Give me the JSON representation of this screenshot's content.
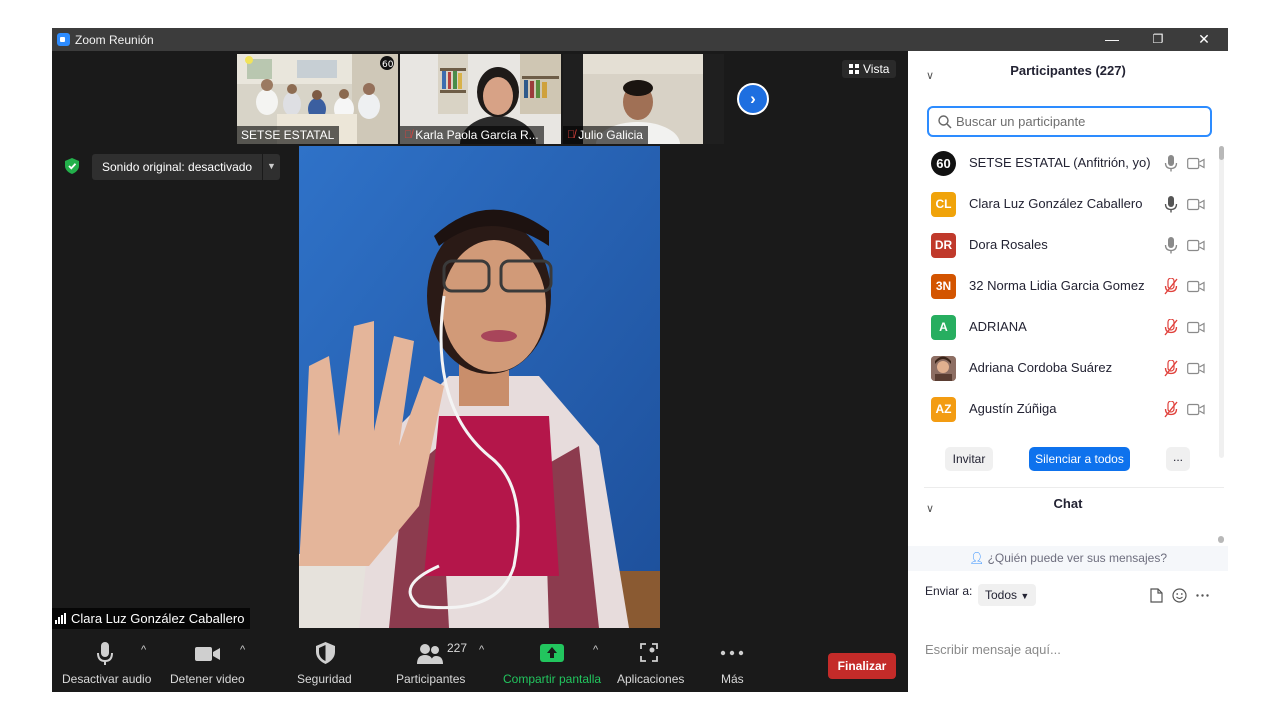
{
  "window": {
    "title": "Zoom Reunión",
    "minimize": "—",
    "restore": "❐",
    "close": "✕"
  },
  "thumbnails": [
    {
      "name": "SETSE ESTATAL",
      "muted": false
    },
    {
      "name": "Karla Paola García R...",
      "muted": true
    },
    {
      "name": "Julio Galicia",
      "muted": true
    }
  ],
  "view_button": "Vista",
  "sound_bar": {
    "label": "Sonido original: desactivado"
  },
  "active_speaker": "Clara Luz González Caballero",
  "toolbar": {
    "audio_label": "Desactivar audio",
    "video_label": "Detener video",
    "security_label": "Seguridad",
    "participants_label": "Participantes",
    "participants_count": "227",
    "share_label": "Compartir pantalla",
    "apps_label": "Aplicaciones",
    "more_label": "Más",
    "end_label": "Finalizar",
    "share_color": "#22c55e"
  },
  "panel": {
    "participants_title": "Participantes (227)",
    "search_placeholder": "Buscar un participante",
    "participants": [
      {
        "initials": "60",
        "name": "SETSE ESTATAL (Anfitrión, yo)",
        "color": "#111111",
        "muted": false
      },
      {
        "initials": "CL",
        "name": "Clara Luz González Caballero",
        "color": "#f0a30a",
        "muted": false
      },
      {
        "initials": "DR",
        "name": "Dora Rosales",
        "color": "#c0392b",
        "muted": false
      },
      {
        "initials": "3N",
        "name": "32 Norma Lidia Garcia Gomez",
        "color": "#d35400",
        "muted": true
      },
      {
        "initials": "A",
        "name": "ADRIANA",
        "color": "#27ae60",
        "muted": true
      },
      {
        "initials": "",
        "name": "Adriana Cordoba Suárez",
        "color": "#8d6e63",
        "muted": true
      },
      {
        "initials": "AZ",
        "name": "Agustín Zúñiga",
        "color": "#f39c12",
        "muted": true
      }
    ],
    "invite_label": "Invitar",
    "mute_all_label": "Silenciar a todos",
    "more_label": "...",
    "chat_title": "Chat",
    "who_can_see": "¿Quién puede ver sus mensajes?",
    "send_to_label": "Enviar a:",
    "send_to_value": "Todos",
    "message_placeholder": "Escribir mensaje aquí..."
  }
}
